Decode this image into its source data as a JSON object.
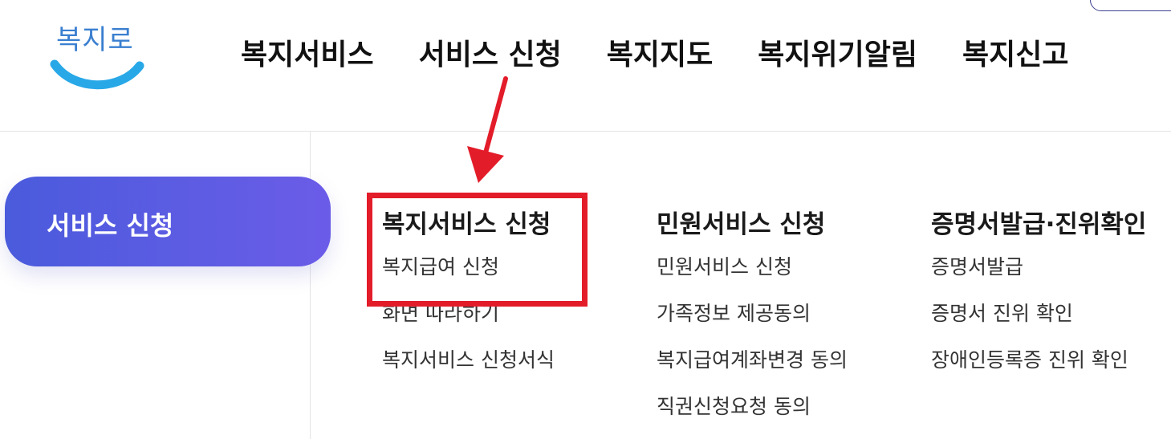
{
  "header": {
    "logo_text": "복지로",
    "nav": [
      "복지서비스",
      "서비스 신청",
      "복지지도",
      "복지위기알림",
      "복지신고"
    ]
  },
  "sidebar": {
    "active_label": "서비스 신청"
  },
  "menu": {
    "columns": [
      {
        "title": "복지서비스 신청",
        "links": [
          "복지급여 신청",
          "화면 따라하기",
          "복지서비스 신청서식"
        ]
      },
      {
        "title": "민원서비스 신청",
        "links": [
          "민원서비스 신청",
          "가족정보 제공동의",
          "복지급여계좌변경 동의",
          "직권신청요청 동의"
        ]
      },
      {
        "title": "증명서발급·진위확인",
        "links": [
          "증명서발급",
          "증명서 진위 확인",
          "장애인등록증 진위 확인"
        ]
      }
    ]
  },
  "colors": {
    "brand_blue": "#3a7fd0",
    "pill_start": "#4a5bdc",
    "pill_end": "#6b5ce8",
    "highlight_red": "#e31c2a"
  }
}
